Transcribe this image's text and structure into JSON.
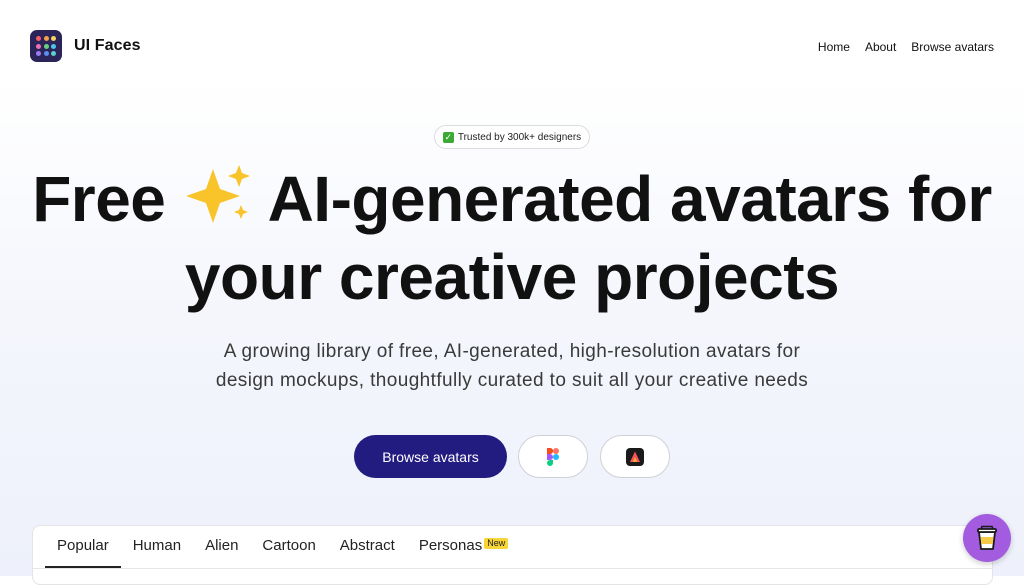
{
  "brand": {
    "name": "UI Faces",
    "icon": "dot-grid-logo"
  },
  "nav": {
    "items": [
      "Home",
      "About",
      "Browse avatars"
    ]
  },
  "hero": {
    "badge": "Trusted by 300k+ designers",
    "badge_icon": "check-mark-icon",
    "headline_part1": "Free",
    "headline_part2": "AI-generated avatars for",
    "headline_line2": "your creative projects",
    "sparkle_icon": "sparkles-icon",
    "subtitle_line1": "A growing library of free, AI-generated, high-resolution avatars for",
    "subtitle_line2": "design mockups, thoughtfully curated to suit all your creative needs"
  },
  "buttons": {
    "primary": "Browse avatars",
    "figma_icon": "figma-icon",
    "adobe_icon": "adobe-express-icon"
  },
  "tabs": {
    "items": [
      "Popular",
      "Human",
      "Alien",
      "Cartoon",
      "Abstract",
      "Personas"
    ],
    "active": "Popular",
    "new_badge": "New"
  },
  "widget": {
    "icon": "coffee-cup-icon"
  },
  "colors": {
    "primary": "#221c80",
    "logo_bg": "#2b2458",
    "coffee": "#a35ce0",
    "new_badge": "#f7d536"
  }
}
